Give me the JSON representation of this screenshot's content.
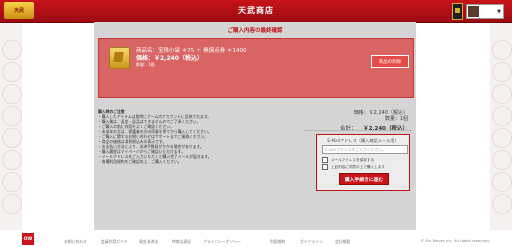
{
  "header": {
    "logo_text": "天武",
    "title": "天武商店",
    "user_caret": "▼"
  },
  "main": {
    "title": "ご購入内容の最終確認",
    "product": {
      "name": "商品名：宝珠小袋 ＊75 ＋ 無償点券 ＊1400",
      "price": "価格：￥2,240（税込）",
      "qty": "数量：1個",
      "change_button": "商品の削除"
    },
    "notes": {
      "heading": "購入時のご注意",
      "lines": [
        "・購入したアイテムは即時にゲーム内アカウントに反映されます。",
        "・購入後は、返金・返品はできませんのでご了承ください。",
        "・ご購入の前に内容をよくご確認ください。",
        "・未成年の方は、保護者の方の同意を得てから購入してください。",
        "・ご購入に関するお問い合わせはサポートまでご連絡ください。",
        "・商品の価格は消費税込みの表示です。",
        "・お支払い方法により、決済手数料がかかる場合があります。",
        "・購入履歴はマイページからご確認いただけます。",
        "・メールアドレスをご入力いただくと購入完了メールが届きます。",
        "・各種利用規約をご確認の上、ご購入ください。"
      ]
    },
    "summary": {
      "price_line": "価格：￥2,240（税込）",
      "qty_line": "数量：1個",
      "total_label": "合計：",
      "total_amount": "￥2,240（税込）"
    },
    "email": {
      "label": "E-Mailアドレス（購入確認メール用）",
      "placeholder": "E-Mailアドレスをご入力ください。",
      "check1": "メールアドレスを保存する",
      "check2": "上記内容に同意の上で購入します",
      "proceed_button": "購入手続きに進む"
    }
  },
  "footer": {
    "logo_text": "OW",
    "links": [
      "お問い合わせ",
      "会員利用ガイド",
      "資金決済法",
      "特商法表記",
      "プライバシーポリシー",
      "利用規約",
      "ガイドライン",
      "会社概要"
    ],
    "copyright": "© Six Waves Inc. All rights reserved."
  }
}
